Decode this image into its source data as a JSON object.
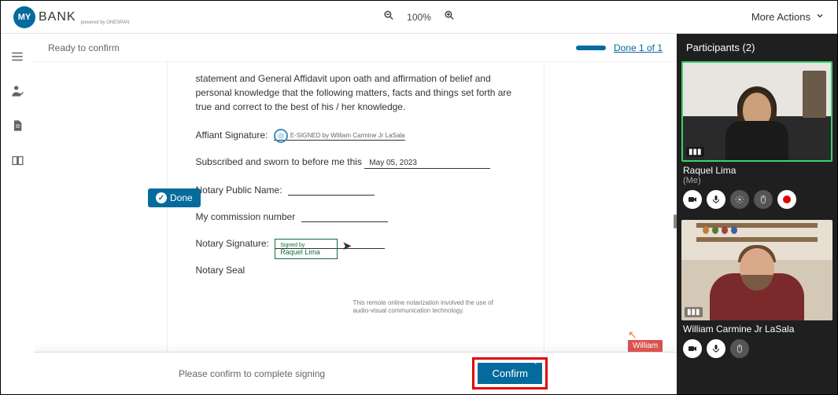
{
  "header": {
    "logo_badge": "MY",
    "logo_text": "BANK",
    "logo_sub": "powered by ONESPAN",
    "zoom": "100%",
    "more_actions": "More Actions"
  },
  "status": {
    "ready": "Ready to confirm",
    "done_link": "Done 1 of 1"
  },
  "done_badge": "Done",
  "document": {
    "intro": "statement and General Affidavit upon oath and affirmation of belief and personal knowledge that the following matters, facts and things set forth are true and correct to the best of his / her knowledge.",
    "affiant_label": "Affiant Signature:",
    "esigned_text": "E-SIGNED by William Carmine Jr LaSala",
    "sworn_label": "Subscribed and sworn to before me this",
    "sworn_date": "May 05, 2023",
    "notary_name_label": "Notary Public Name:",
    "commission_label": "My commission number",
    "notary_sig_label": "Notary Signature:",
    "sig_box_top": "Signed by",
    "sig_box_name": "Raquel Lima",
    "notary_seal_label": "Notary Seal",
    "footnote": "This remote online notarization involved the use of audio-visual communication technology."
  },
  "confirm": {
    "msg": "Please confirm to complete signing",
    "btn": "Confirm"
  },
  "cursor_tag": "William",
  "participants": {
    "title": "Participants (2)",
    "p1_name": "Raquel Lima",
    "p1_sub": "(Me)",
    "p2_name": "William Carmine Jr LaSala"
  }
}
